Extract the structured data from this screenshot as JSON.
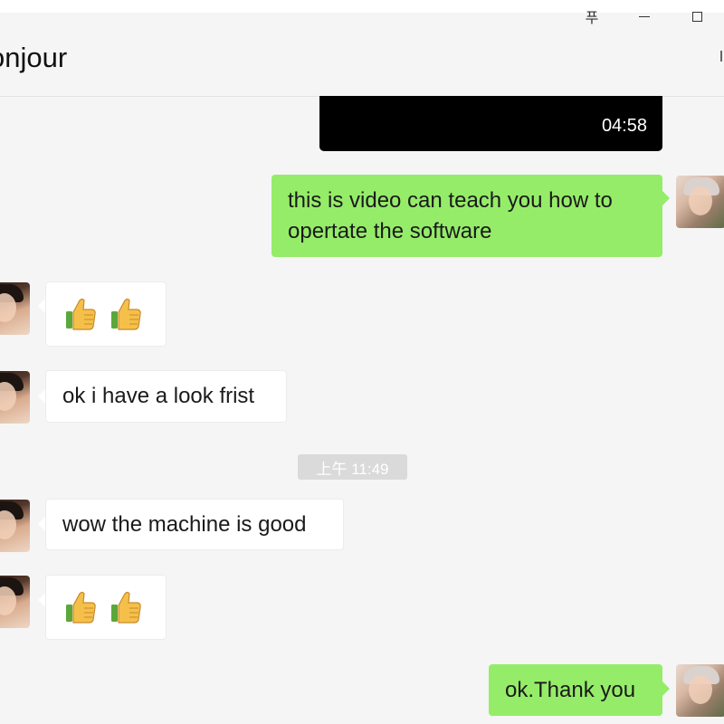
{
  "window": {
    "title": "onjour",
    "pin_glyph": "푸"
  },
  "messages": [
    {
      "id": "video",
      "direction": "out",
      "type": "video",
      "duration": "04:58"
    },
    {
      "id": "m1",
      "direction": "out",
      "type": "text",
      "lines": [
        "this is video can teach you how to",
        "opertate the software"
      ]
    },
    {
      "id": "m2",
      "direction": "in",
      "type": "emoji",
      "emojis": [
        "thumbs-up",
        "thumbs-up"
      ]
    },
    {
      "id": "m3",
      "direction": "in",
      "type": "text",
      "text": "ok i have a look frist"
    },
    {
      "id": "ts",
      "type": "timestamp",
      "text": "上午 11:49"
    },
    {
      "id": "m4",
      "direction": "in",
      "type": "text",
      "text": "wow the machine is good"
    },
    {
      "id": "m5",
      "direction": "in",
      "type": "emoji",
      "emojis": [
        "thumbs-up",
        "thumbs-up"
      ]
    },
    {
      "id": "m6",
      "direction": "out",
      "type": "text",
      "text": "ok.Thank you"
    }
  ],
  "colors": {
    "background": "#f5f5f5",
    "outgoing_bubble": "#95ec69",
    "incoming_bubble": "#ffffff",
    "timestamp_bg": "#dadada"
  }
}
